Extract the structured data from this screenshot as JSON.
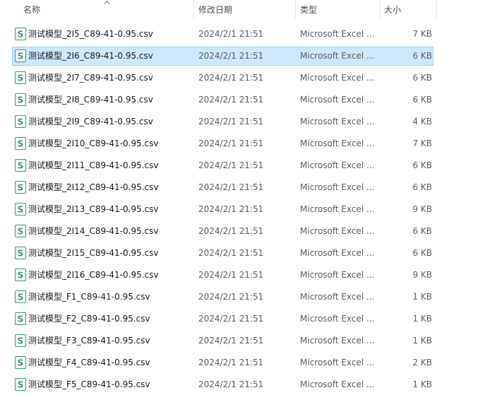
{
  "columns": {
    "name": "名称",
    "date_modified": "修改日期",
    "type": "类型",
    "size": "大小"
  },
  "icon": {
    "file_icon": "wps-spreadsheet-s-icon",
    "file_icon_color": "#2f9e64",
    "sort_icon": "chevron-up-icon"
  },
  "selection_color": "#cce8ff",
  "files": [
    {
      "name": "测试模型_2I5_C89-41-0.95.csv",
      "date": "2024/2/1 21:51",
      "type": "Microsoft Excel ...",
      "size": "7 KB",
      "selected": false
    },
    {
      "name": "测试模型_2I6_C89-41-0.95.csv",
      "date": "2024/2/1 21:51",
      "type": "Microsoft Excel ...",
      "size": "6 KB",
      "selected": true
    },
    {
      "name": "测试模型_2I7_C89-41-0.95.csv",
      "date": "2024/2/1 21:51",
      "type": "Microsoft Excel ...",
      "size": "6 KB",
      "selected": false
    },
    {
      "name": "测试模型_2I8_C89-41-0.95.csv",
      "date": "2024/2/1 21:51",
      "type": "Microsoft Excel ...",
      "size": "6 KB",
      "selected": false
    },
    {
      "name": "测试模型_2I9_C89-41-0.95.csv",
      "date": "2024/2/1 21:51",
      "type": "Microsoft Excel ...",
      "size": "4 KB",
      "selected": false
    },
    {
      "name": "测试模型_2I10_C89-41-0.95.csv",
      "date": "2024/2/1 21:51",
      "type": "Microsoft Excel ...",
      "size": "7 KB",
      "selected": false
    },
    {
      "name": "测试模型_2I11_C89-41-0.95.csv",
      "date": "2024/2/1 21:51",
      "type": "Microsoft Excel ...",
      "size": "6 KB",
      "selected": false
    },
    {
      "name": "测试模型_2I12_C89-41-0.95.csv",
      "date": "2024/2/1 21:51",
      "type": "Microsoft Excel ...",
      "size": "6 KB",
      "selected": false
    },
    {
      "name": "测试模型_2I13_C89-41-0.95.csv",
      "date": "2024/2/1 21:51",
      "type": "Microsoft Excel ...",
      "size": "9 KB",
      "selected": false
    },
    {
      "name": "测试模型_2I14_C89-41-0.95.csv",
      "date": "2024/2/1 21:51",
      "type": "Microsoft Excel ...",
      "size": "6 KB",
      "selected": false
    },
    {
      "name": "测试模型_2I15_C89-41-0.95.csv",
      "date": "2024/2/1 21:51",
      "type": "Microsoft Excel ...",
      "size": "6 KB",
      "selected": false
    },
    {
      "name": "测试模型_2I16_C89-41-0.95.csv",
      "date": "2024/2/1 21:51",
      "type": "Microsoft Excel ...",
      "size": "9 KB",
      "selected": false
    },
    {
      "name": "测试模型_F1_C89-41-0.95.csv",
      "date": "2024/2/1 21:51",
      "type": "Microsoft Excel ...",
      "size": "1 KB",
      "selected": false
    },
    {
      "name": "测试模型_F2_C89-41-0.95.csv",
      "date": "2024/2/1 21:51",
      "type": "Microsoft Excel ...",
      "size": "1 KB",
      "selected": false
    },
    {
      "name": "测试模型_F3_C89-41-0.95.csv",
      "date": "2024/2/1 21:51",
      "type": "Microsoft Excel ...",
      "size": "1 KB",
      "selected": false
    },
    {
      "name": "测试模型_F4_C89-41-0.95.csv",
      "date": "2024/2/1 21:51",
      "type": "Microsoft Excel ...",
      "size": "2 KB",
      "selected": false
    },
    {
      "name": "测试模型_F5_C89-41-0.95.csv",
      "date": "2024/2/1 21:51",
      "type": "Microsoft Excel ...",
      "size": "1 KB",
      "selected": false
    }
  ]
}
